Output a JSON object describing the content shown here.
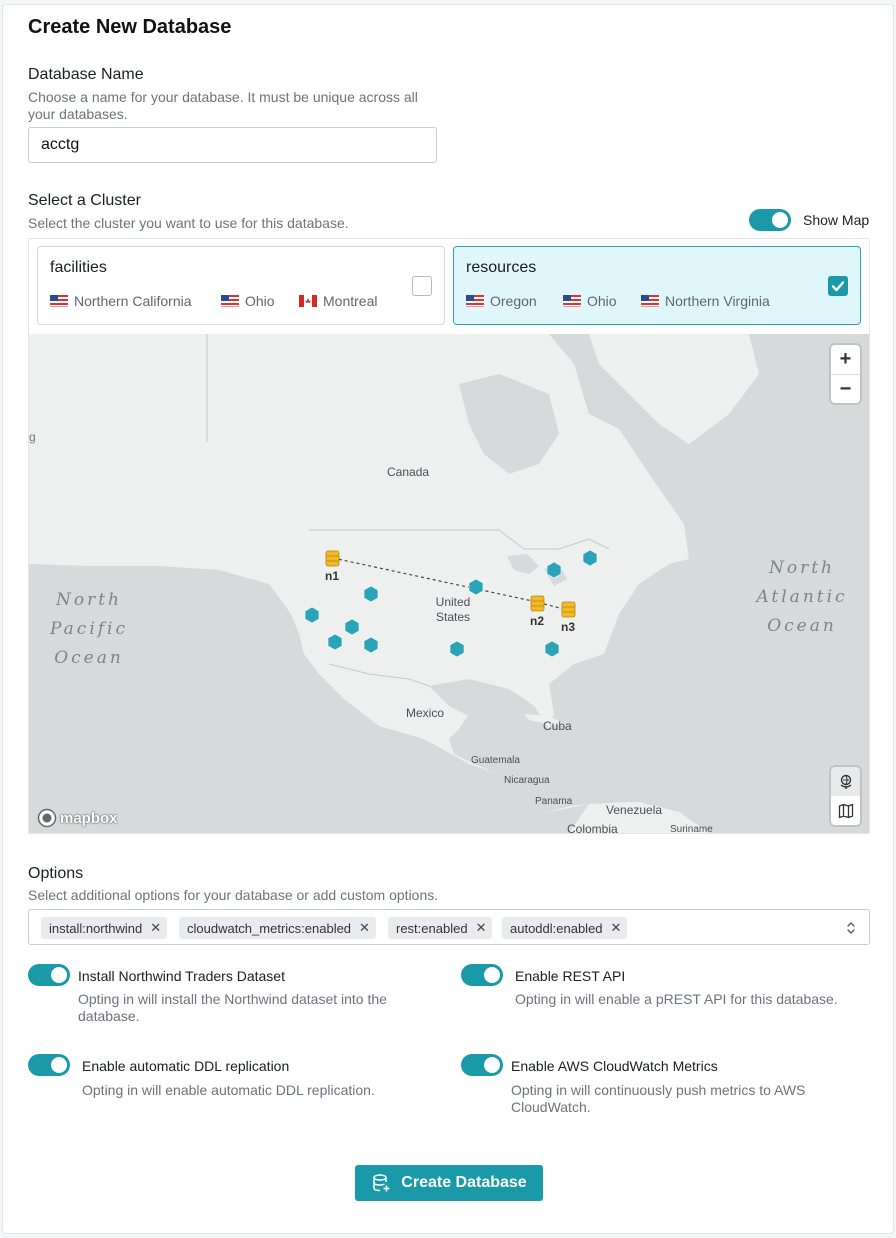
{
  "form": {
    "title": "Create New Database",
    "db_name_label": "Database Name",
    "db_name_help": "Choose a name for your database. It must be unique across all your databases.",
    "db_name_value": "acctg",
    "cluster_label": "Select a Cluster",
    "cluster_help": "Select the cluster you want to use for this database.",
    "show_map_label": "Show Map",
    "show_map_on": true
  },
  "clusters": [
    {
      "name": "facilities",
      "selected": false,
      "regions": [
        {
          "flag": "us-flag-icon",
          "name": "Northern California"
        },
        {
          "flag": "us-flag-icon",
          "name": "Ohio"
        },
        {
          "flag": "canada-flag-icon",
          "name": "Montreal"
        }
      ]
    },
    {
      "name": "resources",
      "selected": true,
      "regions": [
        {
          "flag": "us-flag-icon",
          "name": "Oregon"
        },
        {
          "flag": "us-flag-icon",
          "name": "Ohio"
        },
        {
          "flag": "us-flag-icon",
          "name": "Northern Virginia"
        }
      ]
    }
  ],
  "map": {
    "labels": {
      "canada": "Canada",
      "united_states": "United States",
      "mexico": "Mexico",
      "cuba": "Cuba",
      "guatemala": "Guatemala",
      "nicaragua": "Nicaragua",
      "panama": "Panama",
      "venezuela": "Venezuela",
      "colombia": "Colombia",
      "suriname": "Suriname",
      "partial_g": "g"
    },
    "oceans": {
      "north_pacific": "North Pacific Ocean",
      "north_atlantic": "North Atlantic Ocean"
    },
    "nodes": {
      "n1": "n1",
      "n2": "n2",
      "n3": "n3"
    },
    "zoom_in": "+",
    "zoom_out": "−",
    "attribution": "mapbox"
  },
  "options": {
    "label": "Options",
    "help": "Select additional options for your database or add custom options.",
    "chips": [
      "install:northwind",
      "cloudwatch_metrics:enabled",
      "rest:enabled",
      "autoddl:enabled"
    ],
    "toggles": [
      {
        "title": "Install Northwind Traders Dataset",
        "help": "Opting in will install the Northwind dataset into the database.",
        "on": true
      },
      {
        "title": "Enable REST API",
        "help": "Opting in will enable a pREST API for this database.",
        "on": true
      },
      {
        "title": "Enable automatic DDL replication",
        "help": "Opting in will enable automatic DDL replication.",
        "on": true
      },
      {
        "title": "Enable AWS CloudWatch Metrics",
        "help": "Opting in will continuously push metrics to AWS CloudWatch.",
        "on": true
      }
    ]
  },
  "actions": {
    "create_label": "Create Database"
  },
  "colors": {
    "accent": "#1a9aa8",
    "selected_bg": "#dff7fa",
    "node_gold": "#f2b825"
  }
}
